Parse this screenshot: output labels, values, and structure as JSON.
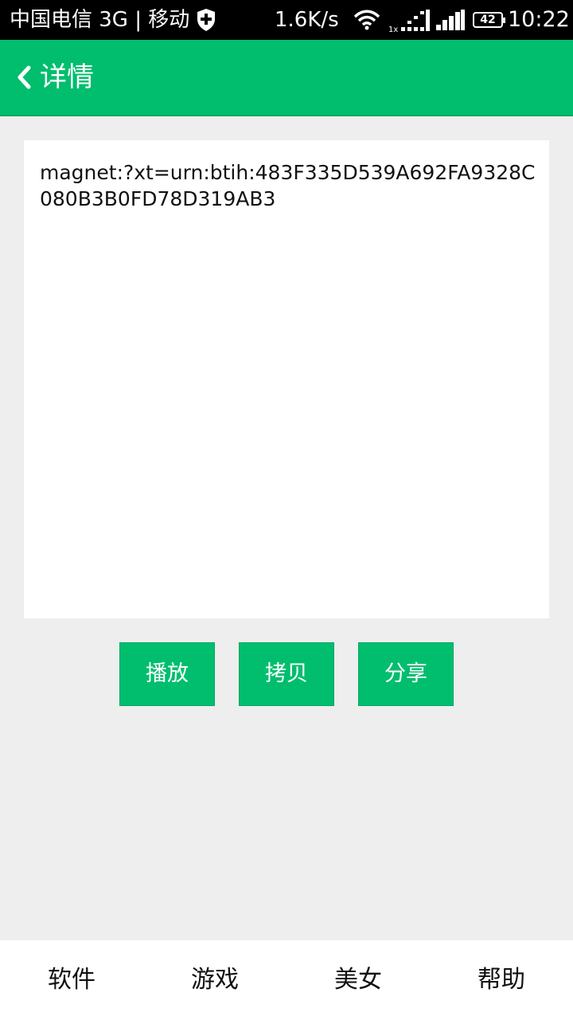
{
  "status_bar": {
    "carrier": "中国电信 3G | 移动",
    "net_speed": "1.6K/s",
    "battery": "42",
    "time": "10:22",
    "icons": [
      "shield-icon",
      "wifi-icon",
      "cell-signal-icon",
      "cell-signal-icon",
      "battery-icon"
    ]
  },
  "app_bar": {
    "title": "详情",
    "back_icon": "chevron-left-icon",
    "color": "#00be6e"
  },
  "detail": {
    "text": "magnet:?xt=urn:btih:483F335D539A692FA9328C080B3B0FD78D319AB3"
  },
  "actions": {
    "play": "播放",
    "copy": "拷贝",
    "share": "分享"
  },
  "bottom_nav": {
    "items": [
      "软件",
      "游戏",
      "美女",
      "帮助"
    ]
  }
}
